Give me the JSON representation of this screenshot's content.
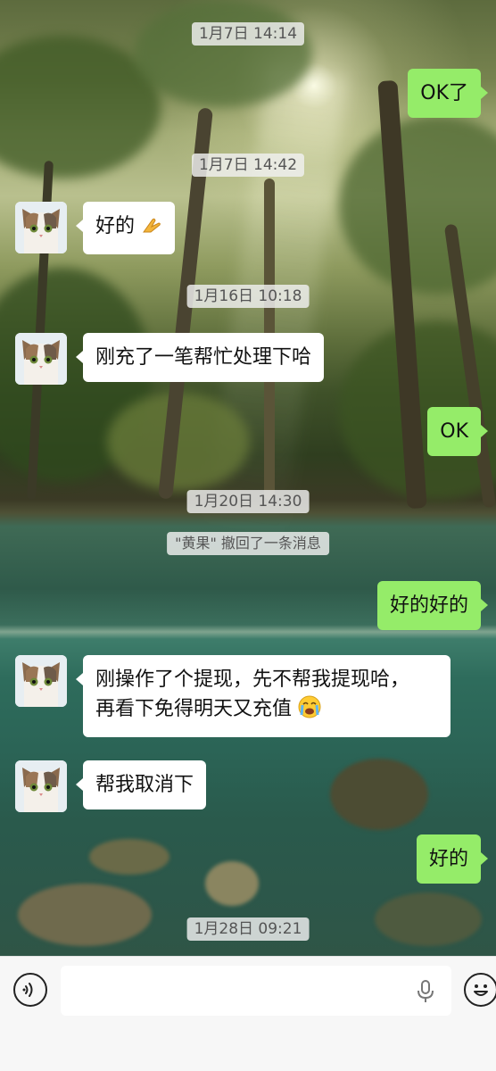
{
  "chat": {
    "timestamps": [
      "1月7日 14:14",
      "1月7日 14:42",
      "1月16日 10:18",
      "1月20日 14:30",
      "1月28日 09:21"
    ],
    "system_notice": "\"黄果\" 撤回了一条消息",
    "messages": [
      {
        "side": "out",
        "text": "OK了"
      },
      {
        "side": "in",
        "text": "好的",
        "emoji": "folded-hands"
      },
      {
        "side": "in",
        "text": "刚充了一笔帮忙处理下哈"
      },
      {
        "side": "out",
        "text": "OK"
      },
      {
        "side": "out",
        "text": "好的好的"
      },
      {
        "side": "in",
        "line1": "刚操作了个提现，先不帮我提现哈，",
        "line2": "再看下免得明天又充值",
        "emoji": "loudly-crying-face"
      },
      {
        "side": "in",
        "text": "帮我取消下"
      },
      {
        "side": "out",
        "text": "好的"
      }
    ]
  },
  "input_bar": {
    "left_icon": "voice-icon",
    "field_icon": "microphone-icon",
    "right_icon": "emoji-icon",
    "message_value": ""
  },
  "colors": {
    "outgoing_bubble": "#95ec69",
    "incoming_bubble": "#ffffff",
    "timestamp_bg": "#f0f0f0"
  }
}
